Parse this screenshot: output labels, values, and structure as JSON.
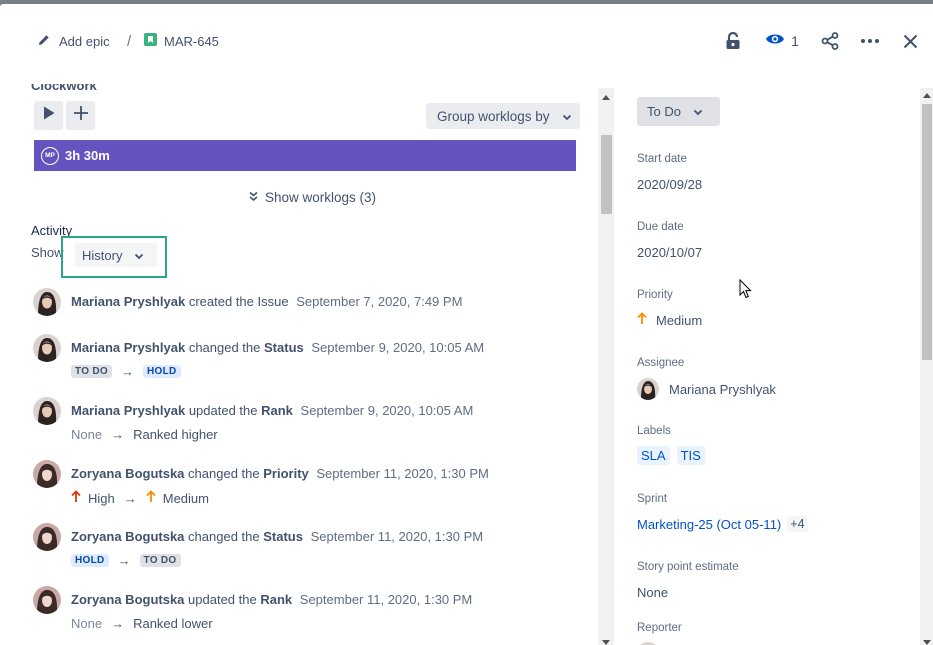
{
  "header": {
    "add_epic": "Add epic",
    "separator": "/",
    "issue_key": "MAR-645",
    "watch_count": "1"
  },
  "clockwork": {
    "title": "Clockwork",
    "group_by": "Group worklogs by",
    "time_logged": "3h 30m",
    "avatar_initials": "MP",
    "show_worklogs": "Show worklogs (3)"
  },
  "activity": {
    "title": "Activity",
    "show_label": "Show",
    "filter": "History",
    "entries": [
      {
        "user": "Mariana Pryshlyak",
        "action": "created the",
        "field": "Issue",
        "date": "September 7, 2020, 7:49 PM"
      },
      {
        "user": "Mariana Pryshlyak",
        "action": "changed the",
        "field": "Status",
        "date": "September 9, 2020, 10:05 AM",
        "from": "TO DO",
        "to": "HOLD"
      },
      {
        "user": "Mariana Pryshlyak",
        "action": "updated the",
        "field": "Rank",
        "date": "September 9, 2020, 10:05 AM",
        "from": "None",
        "to": "Ranked higher"
      },
      {
        "user": "Zoryana Bogutska",
        "action": "changed the",
        "field": "Priority",
        "date": "September 11, 2020, 1:30 PM",
        "from": "High",
        "to": "Medium"
      },
      {
        "user": "Zoryana Bogutska",
        "action": "changed the",
        "field": "Status",
        "date": "September 11, 2020, 1:30 PM",
        "from": "HOLD",
        "to": "TO DO"
      },
      {
        "user": "Zoryana Bogutska",
        "action": "updated the",
        "field": "Rank",
        "date": "September 11, 2020, 1:30 PM",
        "from": "None",
        "to": "Ranked lower"
      }
    ],
    "arrow": "→"
  },
  "details": {
    "status": "To Do",
    "start_date_label": "Start date",
    "start_date": "2020/09/28",
    "due_date_label": "Due date",
    "due_date": "2020/10/07",
    "priority_label": "Priority",
    "priority": "Medium",
    "assignee_label": "Assignee",
    "assignee": "Mariana Pryshlyak",
    "labels_label": "Labels",
    "labels": [
      "SLA",
      "TIS"
    ],
    "sprint_label": "Sprint",
    "sprint": "Marketing-25 (Oct 05-11)",
    "sprint_more": "+4",
    "story_points_label": "Story point estimate",
    "story_points": "None",
    "reporter_label": "Reporter"
  },
  "colors": {
    "timebar": "#6554c0",
    "highlight": "#2aa58a",
    "link": "#0052cc",
    "priority_high": "#de350b",
    "priority_medium": "#ff8b00"
  },
  "icons": [
    "pencil-icon",
    "story-icon",
    "unlock-icon",
    "eye-icon",
    "share-icon",
    "more-icon",
    "close-icon",
    "play-icon",
    "plus-icon",
    "chevron-down-icon",
    "double-chevron-icon",
    "arrow-up-icon"
  ]
}
